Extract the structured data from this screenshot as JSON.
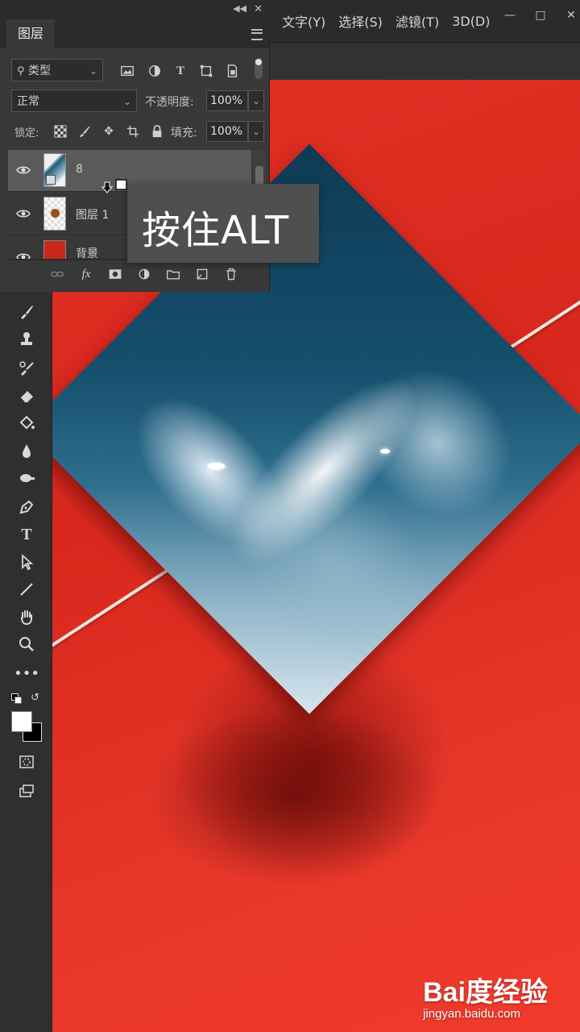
{
  "menubar": {
    "items": [
      "文字(Y)",
      "选择(S)",
      "滤镜(T)",
      "3D(D)"
    ],
    "window_controls": [
      "minimize-icon",
      "maximize-icon",
      "close-icon"
    ]
  },
  "layers_panel": {
    "tab_label": "图层",
    "filter": {
      "kind_value": "类型",
      "icons": [
        "image-filter-icon",
        "adjustment-filter-icon",
        "text-filter-icon",
        "shape-filter-icon",
        "smart-object-filter-icon"
      ]
    },
    "blend_mode": "正常",
    "opacity_label": "不透明度:",
    "opacity_value": "100%",
    "lock_label": "锁定:",
    "fill_label": "填充:",
    "fill_value": "100%",
    "layers": [
      {
        "name": "8",
        "selected": true
      },
      {
        "name": "图层 1",
        "selected": false
      },
      {
        "name": "背景",
        "selected": false
      }
    ],
    "footer_icons": [
      "link-icon",
      "fx-icon",
      "mask-icon",
      "adjustment-icon",
      "folder-icon",
      "new-layer-icon",
      "trash-icon"
    ]
  },
  "tooltip": {
    "text": "按住ALT"
  },
  "tools": [
    "brush-icon",
    "stamp-icon",
    "history-brush-icon",
    "eraser-icon",
    "paint-bucket-icon",
    "blur-icon",
    "dodge-icon",
    "pen-icon",
    "type-icon",
    "path-select-icon",
    "line-icon",
    "hand-icon",
    "zoom-icon",
    "more-icon"
  ],
  "colors": {
    "canvas_red": "#e23024",
    "panel_bg": "#383838",
    "selected_layer": "#5a5a5a"
  },
  "watermark": {
    "logo": "Bai度经验",
    "url": "jingyan.baidu.com"
  }
}
